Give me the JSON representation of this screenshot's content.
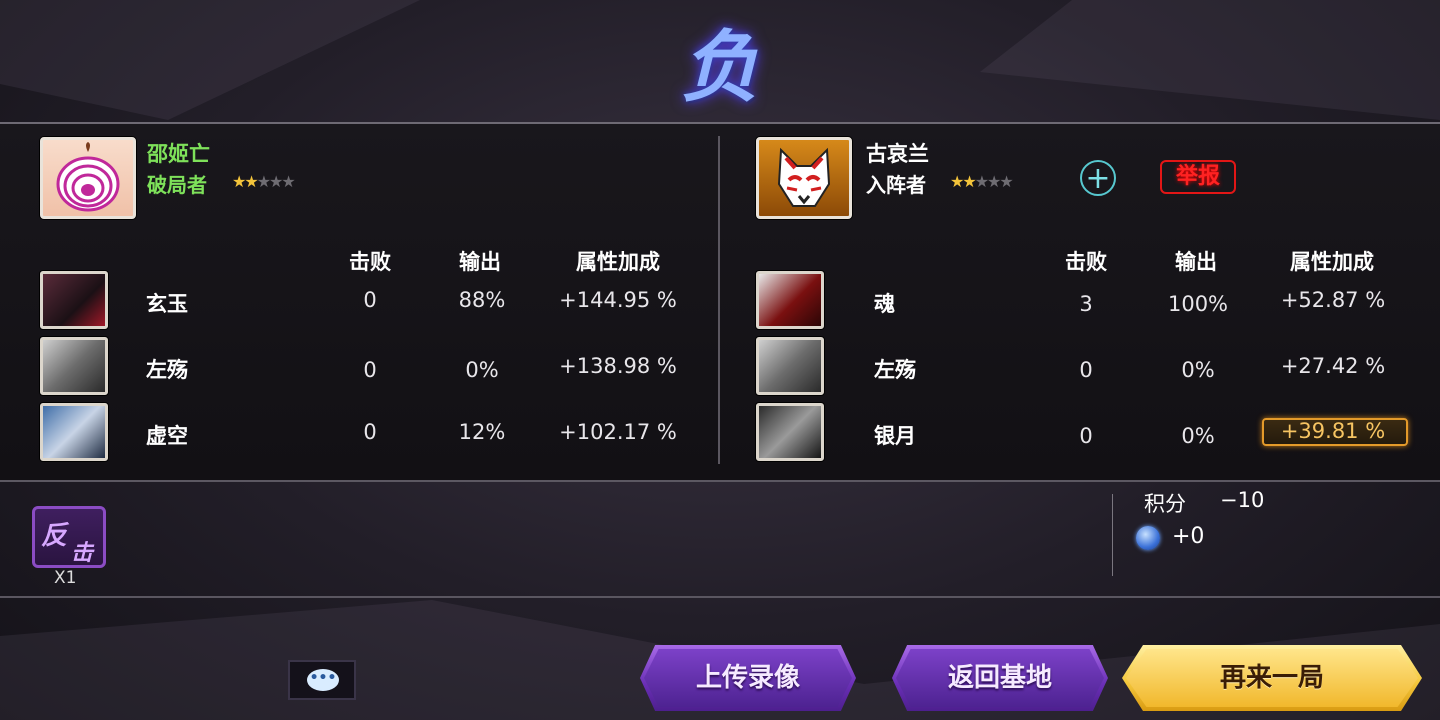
{
  "result": {
    "title": "负"
  },
  "left_player": {
    "name": "邵姬亡",
    "role": "破局者",
    "stars_on": "★★",
    "stars_off": "★★★",
    "name_color": "#7ee15a"
  },
  "right_player": {
    "name": "古哀兰",
    "role": "入阵者",
    "stars_on": "★★",
    "stars_off": "★★★",
    "add_icon": "+",
    "report_label": "举报"
  },
  "columns": {
    "defeat": "击败",
    "output": "输出",
    "bonus": "属性加成"
  },
  "left_heroes": [
    {
      "name": "玄玉",
      "defeat": "0",
      "output": "88%",
      "bonus": "+144.95 %"
    },
    {
      "name": "左殇",
      "defeat": "0",
      "output": "0%",
      "bonus": "+138.98 %"
    },
    {
      "name": "虚空",
      "defeat": "0",
      "output": "12%",
      "bonus": "+102.17 %"
    }
  ],
  "right_heroes": [
    {
      "name": "魂",
      "defeat": "3",
      "output": "100%",
      "bonus": "+52.87 %"
    },
    {
      "name": "左殇",
      "defeat": "0",
      "output": "0%",
      "bonus": "+27.42 %"
    },
    {
      "name": "银月",
      "defeat": "0",
      "output": "0%",
      "bonus": "+39.81 %"
    }
  ],
  "counter_badge": {
    "char1": "反",
    "char2": "击",
    "count": "X1"
  },
  "score": {
    "label": "积分",
    "value": "−10",
    "gem_value": "+0",
    "gem_icon": "shield-gem-icon"
  },
  "chat": {
    "icon": "chat-bubble-icon",
    "dots": "•••"
  },
  "buttons": {
    "upload": "上传录像",
    "back": "返回基地",
    "again": "再来一局"
  }
}
